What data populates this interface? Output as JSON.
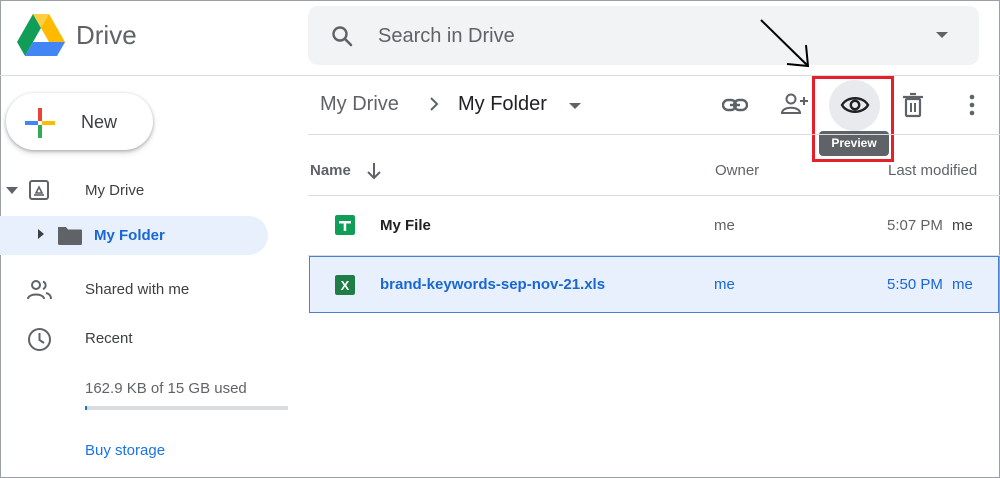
{
  "header": {
    "brand": "Drive",
    "search_placeholder": "Search in Drive"
  },
  "sidebar": {
    "new_label": "New",
    "items": [
      {
        "label": "My Drive"
      },
      {
        "label": "My Folder"
      },
      {
        "label": "Shared with me"
      },
      {
        "label": "Recent"
      }
    ],
    "storage_text": "162.9 KB of 15 GB used",
    "storage_fraction": 0.0,
    "buy_storage": "Buy storage"
  },
  "breadcrumb": {
    "root": "My Drive",
    "current": "My Folder"
  },
  "toolbar": {
    "tooltip": "Preview",
    "icons": [
      "link-icon",
      "add-person-icon",
      "preview-eye-icon",
      "trash-icon",
      "more-vert-icon"
    ]
  },
  "table": {
    "headers": {
      "name": "Name",
      "owner": "Owner",
      "modified": "Last modified"
    },
    "rows": [
      {
        "name": "My File",
        "owner": "me",
        "modified_time": "5:07 PM",
        "modified_by": "me",
        "type": "google-sheets"
      },
      {
        "name": "brand-keywords-sep-nov-21.xls",
        "owner": "me",
        "modified_time": "5:50 PM",
        "modified_by": "me",
        "type": "excel"
      }
    ]
  },
  "colors": {
    "accent_blue": "#1a73e8",
    "selected_bg": "#e8f0fe",
    "highlight_red": "#e5202a",
    "sheets_green": "#0f9d58",
    "excel_green": "#1e7e45"
  }
}
